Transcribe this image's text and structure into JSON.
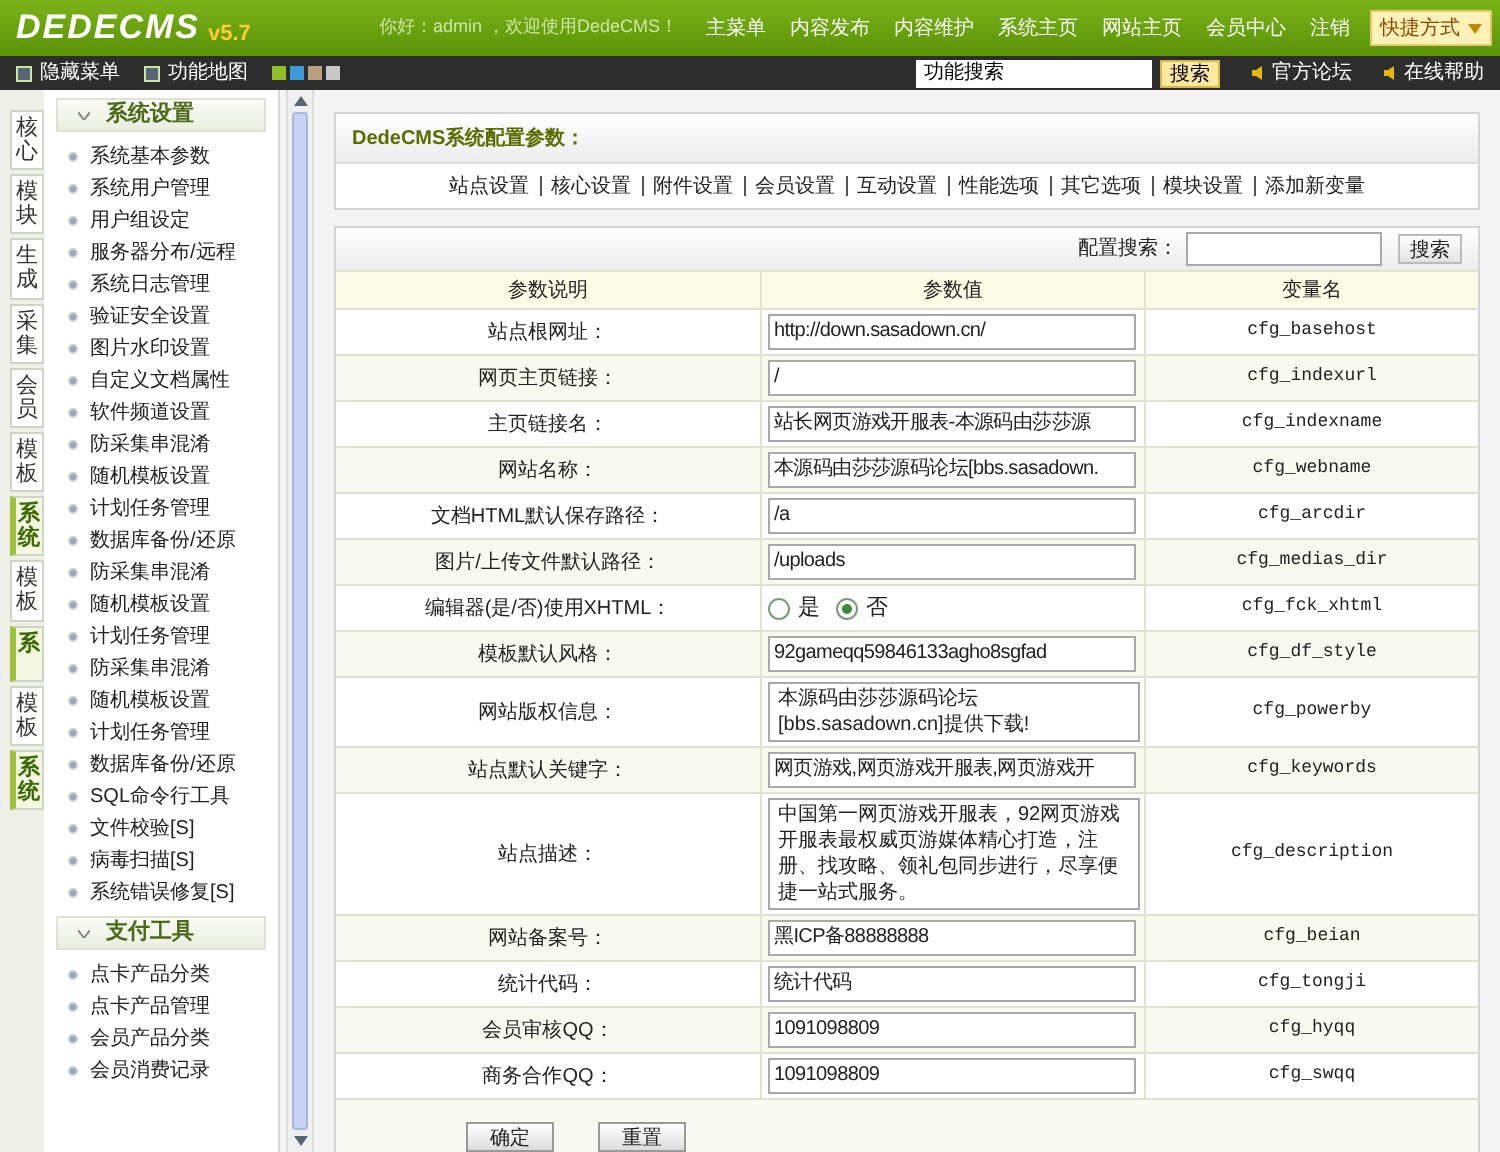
{
  "logo": {
    "name": "DEDECMS",
    "version": "v5.7"
  },
  "top_nav": {
    "greeting": "你好：admin ，欢迎使用DedeCMS！",
    "items": [
      "主菜单",
      "内容发布",
      "内容维护",
      "系统主页",
      "网站主页",
      "会员中心",
      "注销"
    ],
    "quick_menu": "快捷方式"
  },
  "toolbar": {
    "items": [
      "隐藏菜单",
      "功能地图"
    ],
    "skins": [
      {
        "color": "#8fc02a"
      },
      {
        "color": "#3d9bd6"
      },
      {
        "color": "#b8a07a"
      },
      {
        "color": "#c8c8c8"
      }
    ],
    "search": {
      "value": "功能搜索",
      "button": "搜索"
    },
    "links": [
      "官方论坛",
      "在线帮助"
    ]
  },
  "side_tabs": [
    {
      "label": "核心",
      "selected": false
    },
    {
      "label": "模块",
      "selected": false
    },
    {
      "label": "生成",
      "selected": false
    },
    {
      "label": "采集",
      "selected": false
    },
    {
      "label": "会员",
      "selected": false
    },
    {
      "label": "模板",
      "selected": false
    },
    {
      "label": "系统",
      "selected": true
    },
    {
      "label": "模板",
      "selected": false
    },
    {
      "label": "系",
      "selected": true
    },
    {
      "label": "模板",
      "selected": false
    },
    {
      "label": "系统",
      "selected": true
    }
  ],
  "menu_groups": [
    {
      "title": "系统设置",
      "items": [
        "系统基本参数",
        "系统用户管理",
        "用户组设定",
        "服务器分布/远程",
        "系统日志管理",
        "验证安全设置",
        "图片水印设置",
        "自定义文档属性",
        "软件频道设置",
        "防采集串混淆",
        "随机模板设置",
        "计划任务管理",
        "数据库备份/还原",
        "防采集串混淆",
        "随机模板设置",
        "计划任务管理",
        "防采集串混淆",
        "随机模板设置",
        "计划任务管理",
        "数据库备份/还原",
        "SQL命令行工具",
        "文件校验[S]",
        "病毒扫描[S]",
        "系统错误修复[S]"
      ]
    },
    {
      "title": "支付工具",
      "items": [
        "点卡产品分类",
        "点卡产品管理",
        "会员产品分类",
        "会员消费记录"
      ]
    }
  ],
  "panel": {
    "title": "DedeCMS系统配置参数：",
    "tabs": [
      "站点设置",
      "核心设置",
      "附件设置",
      "会员设置",
      "互动设置",
      "性能选项",
      "其它选项",
      "模块设置",
      "添加新变量"
    ]
  },
  "config_search": {
    "label": "配置搜索：",
    "button": "搜索"
  },
  "table": {
    "columns": [
      "参数说明",
      "参数值",
      "变量名"
    ],
    "rows": [
      {
        "kind": "input",
        "label": "站点根网址：",
        "value": "http://down.sasadown.cn/",
        "var": "cfg_basehost"
      },
      {
        "kind": "input",
        "label": "网页主页链接：",
        "value": "/",
        "var": "cfg_indexurl"
      },
      {
        "kind": "input",
        "label": "主页链接名：",
        "value": "站长网页游戏开服表-本源码由莎莎源",
        "var": "cfg_indexname"
      },
      {
        "kind": "input",
        "label": "网站名称：",
        "value": "本源码由莎莎源码论坛[bbs.sasadown.",
        "var": "cfg_webname"
      },
      {
        "kind": "input",
        "label": "文档HTML默认保存路径：",
        "value": "/a",
        "var": "cfg_arcdir"
      },
      {
        "kind": "input",
        "label": "图片/上传文件默认路径：",
        "value": "/uploads",
        "var": "cfg_medias_dir"
      },
      {
        "kind": "radio",
        "label": "编辑器(是/否)使用XHTML：",
        "options": [
          {
            "label": "是",
            "selected": false
          },
          {
            "label": "否",
            "selected": true
          }
        ],
        "var": "cfg_fck_xhtml"
      },
      {
        "kind": "input",
        "label": "模板默认风格：",
        "value": "92gameqq59846133agho8sgfad",
        "var": "cfg_df_style"
      },
      {
        "kind": "textarea",
        "label": "网站版权信息：",
        "value": "本源码由莎莎源码论坛[bbs.sasadown.cn]提供下载!",
        "var": "cfg_powerby"
      },
      {
        "kind": "input",
        "label": "站点默认关键字：",
        "value": "网页游戏,网页游戏开服表,网页游戏开",
        "var": "cfg_keywords"
      },
      {
        "kind": "textarea",
        "label": "站点描述：",
        "value": "中国第一网页游戏开服表，92网页游戏开服表最权威页游媒体精心打造，注册、找攻略、领礼包同步进行，尽享便捷一站式服务。",
        "var": "cfg_description"
      },
      {
        "kind": "input",
        "label": "网站备案号：",
        "value": "黑ICP备88888888",
        "var": "cfg_beian"
      },
      {
        "kind": "input",
        "label": "统计代码：",
        "value": "统计代码",
        "var": "cfg_tongji"
      },
      {
        "kind": "input",
        "label": "会员审核QQ：",
        "value": "1091098809",
        "var": "cfg_hyqq"
      },
      {
        "kind": "input",
        "label": "商务合作QQ：",
        "value": "1091098809",
        "var": "cfg_swqq"
      }
    ]
  },
  "buttons": [
    "确定",
    "重置"
  ]
}
